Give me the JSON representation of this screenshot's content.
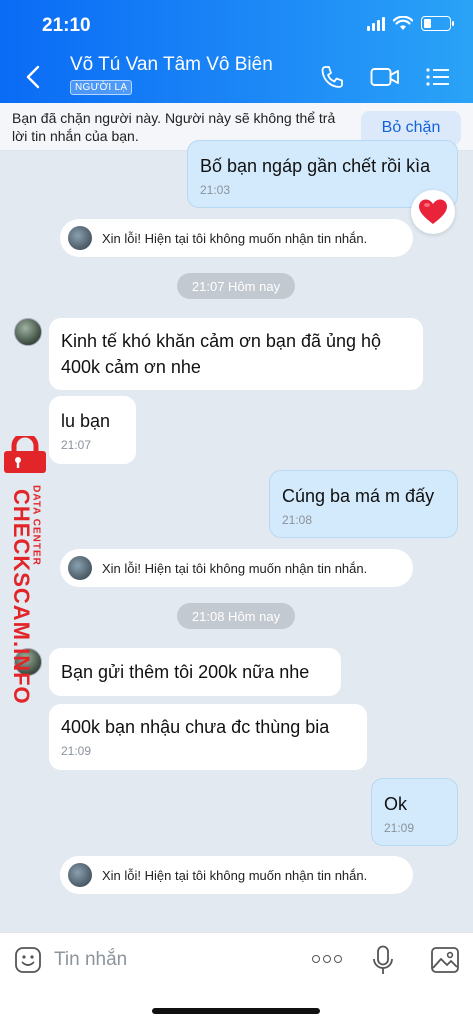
{
  "status_bar": {
    "time": "21:10"
  },
  "header": {
    "contact_name": "Võ Tú Van Tâm Vô Biên",
    "badge": "NGƯỜI LẠ"
  },
  "block_banner": {
    "text": "Bạn đã chặn người này. Người này sẽ không thể trả lời tin nhắn của bạn.",
    "unblock_label": "Bỏ chặn"
  },
  "messages": [
    {
      "dir": "out",
      "text": "Bố bạn ngáp gần chết rồi kìa",
      "time": "21:03"
    },
    {
      "dir": "notice",
      "text": "Xin lỗi! Hiện tại tôi không muốn nhận tin nhắn."
    },
    {
      "dir": "divider",
      "text": "21:07 Hôm nay"
    },
    {
      "dir": "in",
      "text": "Kinh tế khó khăn cảm ơn bạn đã ủng hộ 400k cảm ơn nhe"
    },
    {
      "dir": "in",
      "text": "lu bạn",
      "time": "21:07"
    },
    {
      "dir": "out",
      "text": "Cúng ba má m đấy",
      "time": "21:08"
    },
    {
      "dir": "notice",
      "text": "Xin lỗi! Hiện tại tôi không muốn nhận tin nhắn."
    },
    {
      "dir": "divider",
      "text": "21:08 Hôm nay"
    },
    {
      "dir": "in",
      "text": "Bạn gửi thêm tôi 200k nữa nhe"
    },
    {
      "dir": "in",
      "text": "400k bạn nhậu chưa đc thùng bia",
      "time": "21:09"
    },
    {
      "dir": "out",
      "text": "Ok",
      "time": "21:09"
    },
    {
      "dir": "notice",
      "text": "Xin lỗi! Hiện tại tôi không muốn nhận tin nhắn."
    }
  ],
  "watermark": {
    "site": "CHECKSCAM.INFO",
    "label": "DATA CENTER"
  },
  "input": {
    "placeholder": "Tin nhắn"
  },
  "colors": {
    "header": "#0a6bf5",
    "outgoing": "#d3eafc",
    "incoming": "#ffffff",
    "watermark": "#e12528"
  }
}
